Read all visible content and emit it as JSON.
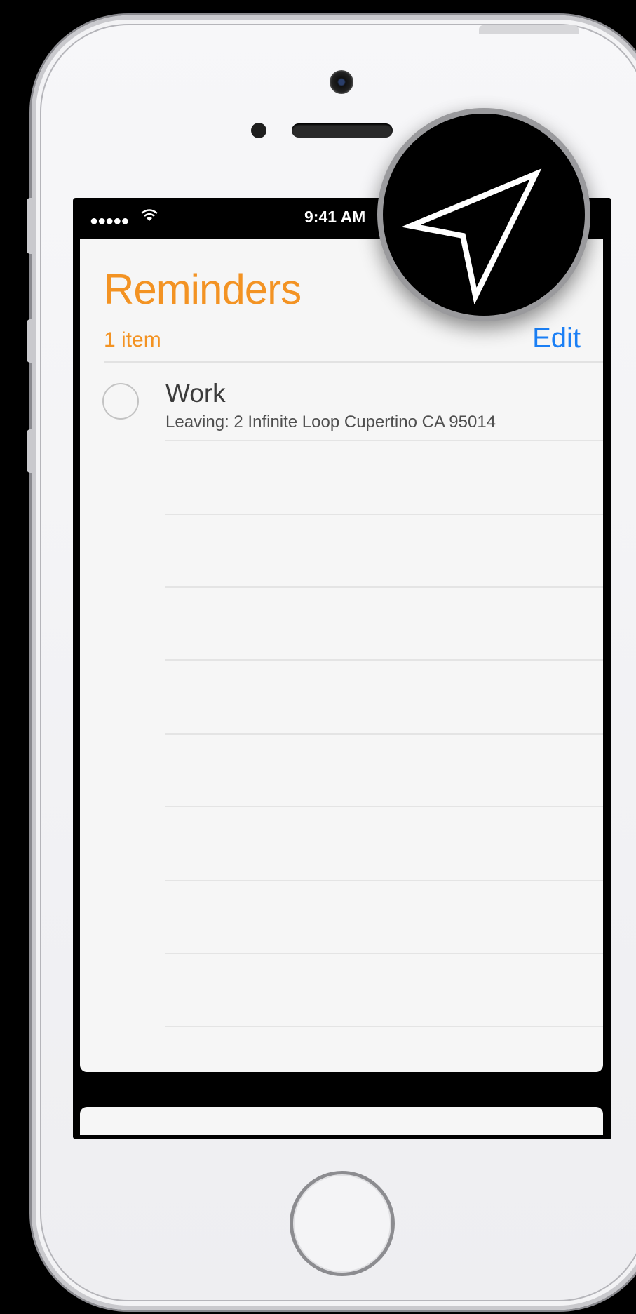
{
  "status_bar": {
    "signal": "●●●●●",
    "wifi": "wifi-icon",
    "time": "9:41 AM"
  },
  "reminders": {
    "title": "Reminders",
    "item_count": "1 item",
    "edit_label": "Edit",
    "items": [
      {
        "title": "Work",
        "subtitle": "Leaving: 2 Infinite Loop Cupertino CA 95014",
        "completed": false
      }
    ]
  },
  "overlay": {
    "icon": "location-arrow-icon"
  },
  "colors": {
    "accent_orange": "#f39323",
    "link_blue": "#1a7ff5"
  }
}
